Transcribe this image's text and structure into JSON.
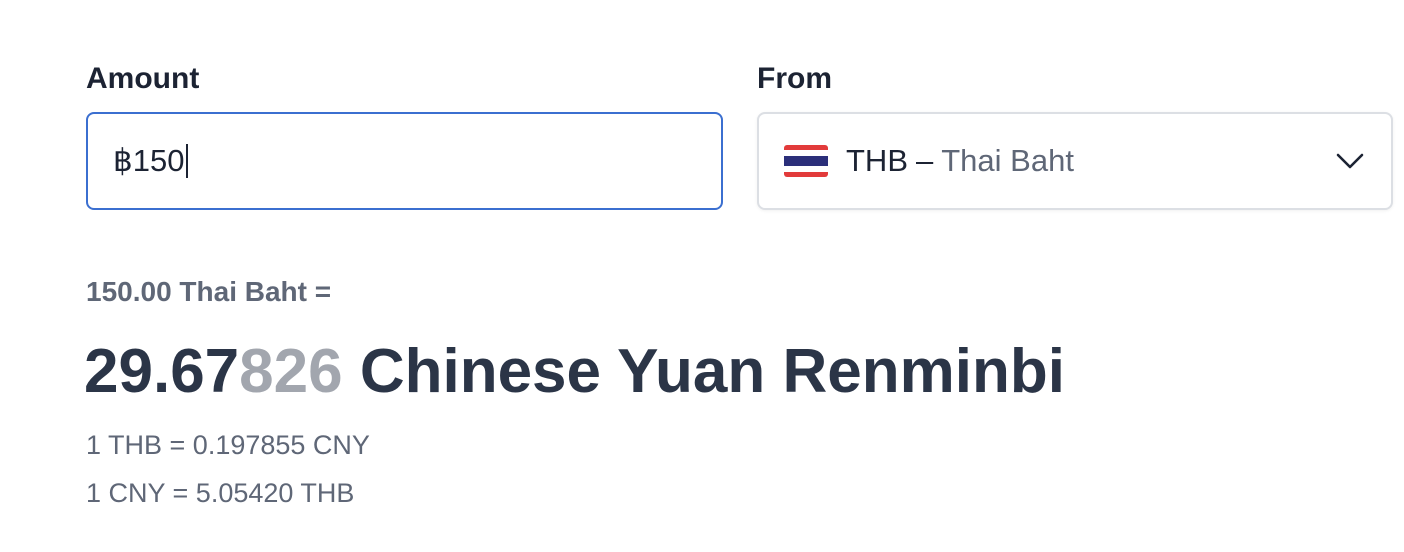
{
  "amount": {
    "label": "Amount",
    "value": "฿150"
  },
  "from": {
    "label": "From",
    "currency_code": "THB",
    "separator": "–",
    "currency_name": "Thai Baht",
    "flag_icon": "thailand-flag-icon"
  },
  "conversion": {
    "from_text": "150.00 Thai Baht =",
    "result_main": "29.67",
    "result_faded": "826",
    "result_currency": " Chinese Yuan Renminbi",
    "rate_forward": "1 THB = 0.197855 CNY",
    "rate_reverse": "1 CNY = 5.05420 THB"
  },
  "colors": {
    "input_focus_border": "#3b6fd0",
    "text_primary": "#1c2333",
    "text_secondary": "#5f6777",
    "text_faded": "#a2a6ae"
  }
}
